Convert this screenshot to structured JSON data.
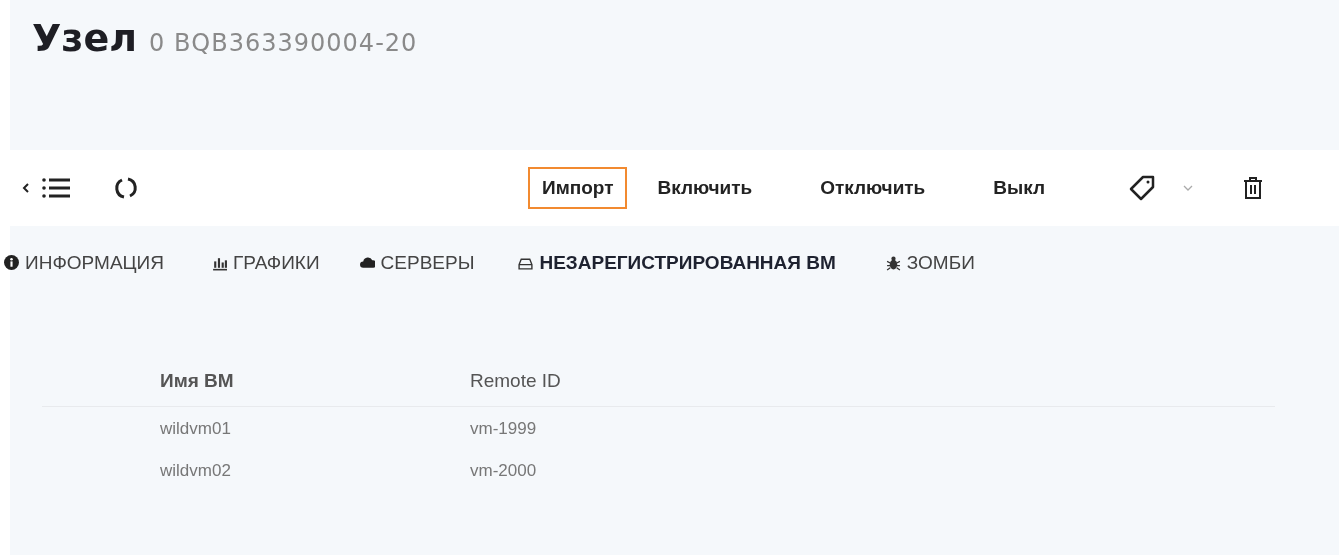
{
  "title": {
    "main": "Узел",
    "sub": "0 BQB363390004-20"
  },
  "toolbar": {
    "actions": [
      {
        "label": "Импорт",
        "focused": true
      },
      {
        "label": "Включить",
        "focused": false
      },
      {
        "label": "Отключить",
        "focused": false
      },
      {
        "label": "Выкл",
        "focused": false
      }
    ]
  },
  "tabs": [
    {
      "label": "ИНФОРМАЦИЯ",
      "selected": false
    },
    {
      "label": "ГРАФИКИ",
      "selected": false
    },
    {
      "label": "СЕРВЕРЫ",
      "selected": false
    },
    {
      "label": "НЕЗАРЕГИСТРИРОВАННАЯ ВМ",
      "selected": true
    },
    {
      "label": "ЗОМБИ",
      "selected": false
    }
  ],
  "table": {
    "columns": [
      "Имя ВМ",
      "Remote ID"
    ],
    "rows": [
      [
        "wildvm01",
        "vm-1999"
      ],
      [
        "wildvm02",
        "vm-2000"
      ]
    ]
  }
}
